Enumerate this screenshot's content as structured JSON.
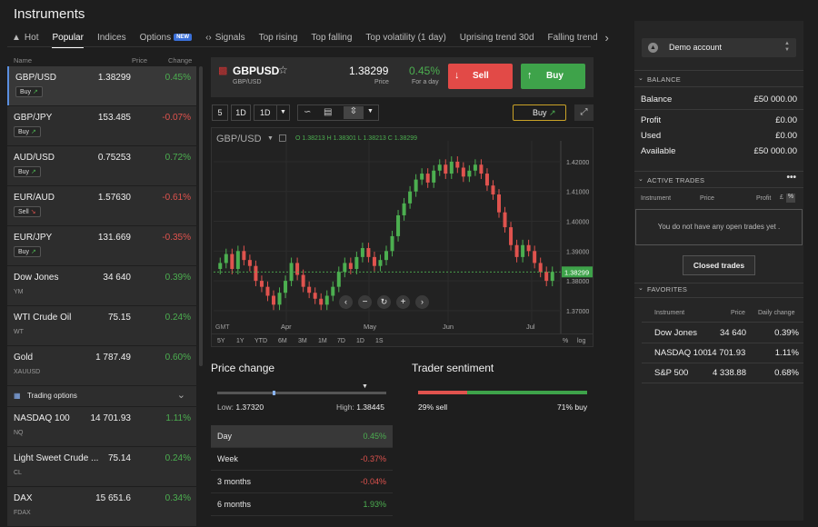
{
  "title": "Instruments",
  "tabs": [
    {
      "label": "Hot"
    },
    {
      "label": "Popular"
    },
    {
      "label": "Indices"
    },
    {
      "label": "Options",
      "badge": "NEW"
    },
    {
      "label": "Signals"
    },
    {
      "label": "Top rising"
    },
    {
      "label": "Top falling"
    },
    {
      "label": "Top volatility (1 day)"
    },
    {
      "label": "Uprising trend 30d"
    },
    {
      "label": "Falling trend"
    }
  ],
  "list_header": {
    "name": "Name",
    "price": "Price",
    "change": "Change"
  },
  "instruments": [
    {
      "name": "GBP/USD",
      "price": "1.38299",
      "change": "0.45%",
      "dir": "pos",
      "action": "Buy",
      "sub": ""
    },
    {
      "name": "GBP/JPY",
      "price": "153.485",
      "change": "-0.07%",
      "dir": "neg",
      "action": "Buy",
      "sub": ""
    },
    {
      "name": "AUD/USD",
      "price": "0.75253",
      "change": "0.72%",
      "dir": "pos",
      "action": "Buy",
      "sub": ""
    },
    {
      "name": "EUR/AUD",
      "price": "1.57630",
      "change": "-0.61%",
      "dir": "neg",
      "action": "Sell",
      "sub": ""
    },
    {
      "name": "EUR/JPY",
      "price": "131.669",
      "change": "-0.35%",
      "dir": "neg",
      "action": "Buy",
      "sub": ""
    },
    {
      "name": "Dow Jones",
      "price": "34 640",
      "change": "0.39%",
      "dir": "pos",
      "action": "",
      "sub": "YM"
    },
    {
      "name": "WTI Crude Oil",
      "price": "75.15",
      "change": "0.24%",
      "dir": "pos",
      "action": "",
      "sub": "WT"
    },
    {
      "name": "Gold",
      "price": "1 787.49",
      "change": "0.60%",
      "dir": "pos",
      "action": "",
      "sub": "XAUUSD"
    }
  ],
  "trading_options_label": "Trading options",
  "instruments2": [
    {
      "name": "NASDAQ 100",
      "price": "14 701.93",
      "change": "1.11%",
      "dir": "pos",
      "sub": "NQ"
    },
    {
      "name": "Light Sweet Crude ...",
      "price": "75.14",
      "change": "0.24%",
      "dir": "pos",
      "sub": "CL"
    },
    {
      "name": "DAX",
      "price": "15 651.6",
      "change": "0.34%",
      "dir": "pos",
      "sub": "FDAX"
    }
  ],
  "header": {
    "symbol": "GBPUSD",
    "subsymbol": "GBP/USD",
    "price": "1.38299",
    "price_label": "Price",
    "change": "0.45%",
    "change_label": "For a day",
    "sell": "Sell",
    "buy": "Buy"
  },
  "toolbar": {
    "interval1": "5",
    "interval2": "1D",
    "interval3": "1D",
    "buy_small": "Buy"
  },
  "chart": {
    "legend_symbol": "GBP/USD",
    "ohlc": "O 1.38213  H 1.38301  L 1.38213  C 1.38299",
    "price_tag": "1.38299",
    "gmt": "GMT",
    "ranges": [
      "5Y",
      "1Y",
      "YTD",
      "6M",
      "3M",
      "1M",
      "7D",
      "1D",
      "1S"
    ],
    "pct": "%",
    "log": "log"
  },
  "chart_data": {
    "type": "candlestick",
    "x_labels": [
      "Apr",
      "May",
      "Jun",
      "Jul"
    ],
    "y_ticks": [
      "1.42000",
      "1.41000",
      "1.40000",
      "1.39000",
      "1.38000",
      "1.37000"
    ],
    "ylim": [
      1.366,
      1.427
    ],
    "series": [
      {
        "values": [
          1.386,
          1.389,
          1.384,
          1.39,
          1.387,
          1.385,
          1.38,
          1.378,
          1.375,
          1.372,
          1.376,
          1.38,
          1.386,
          1.382,
          1.378,
          1.376,
          1.374,
          1.372,
          1.375,
          1.378,
          1.383,
          1.386,
          1.384,
          1.388,
          1.391,
          1.388,
          1.385,
          1.387,
          1.39,
          1.395,
          1.402,
          1.406,
          1.41,
          1.414,
          1.416,
          1.413,
          1.417,
          1.419,
          1.416,
          1.42,
          1.418,
          1.415,
          1.417,
          1.419,
          1.416,
          1.412,
          1.409,
          1.403,
          1.398,
          1.392,
          1.388,
          1.392,
          1.39,
          1.386,
          1.383,
          1.38,
          1.383
        ]
      }
    ]
  },
  "price_change": {
    "title": "Price change",
    "low_label": "Low:",
    "low": "1.37320",
    "high_label": "High:",
    "high": "1.38445",
    "rows": [
      {
        "label": "Day",
        "value": "0.45%",
        "dir": "pos"
      },
      {
        "label": "Week",
        "value": "-0.37%",
        "dir": "neg"
      },
      {
        "label": "3 months",
        "value": "-0.04%",
        "dir": "neg"
      },
      {
        "label": "6 months",
        "value": "1.93%",
        "dir": "pos"
      }
    ]
  },
  "sentiment": {
    "title": "Trader sentiment",
    "sell": "29% sell",
    "buy": "71% buy",
    "sell_pct": 29
  },
  "account": {
    "name": "Demo account"
  },
  "balance": {
    "title": "BALANCE",
    "balance_label": "Balance",
    "balance": "£50 000.00",
    "profit_label": "Profit",
    "profit": "£0.00",
    "used_label": "Used",
    "used": "£0.00",
    "available_label": "Available",
    "available": "£50 000.00"
  },
  "active_trades": {
    "title": "ACTIVE TRADES",
    "col1": "Instrument",
    "col2": "Price",
    "col3": "Profit",
    "cur": "£",
    "pct": "%",
    "empty": "You do not have any open trades yet .",
    "closed_btn": "Closed trades"
  },
  "favorites": {
    "title": "FAVORITES",
    "col1": "Instrument",
    "col2": "Price",
    "col3": "Daily change",
    "rows": [
      {
        "name": "Dow Jones",
        "price": "34 640",
        "change": "0.39%"
      },
      {
        "name": "NASDAQ 100",
        "price": "14 701.93",
        "change": "1.11%"
      },
      {
        "name": "S&P 500",
        "price": "4 338.88",
        "change": "0.68%"
      }
    ]
  }
}
